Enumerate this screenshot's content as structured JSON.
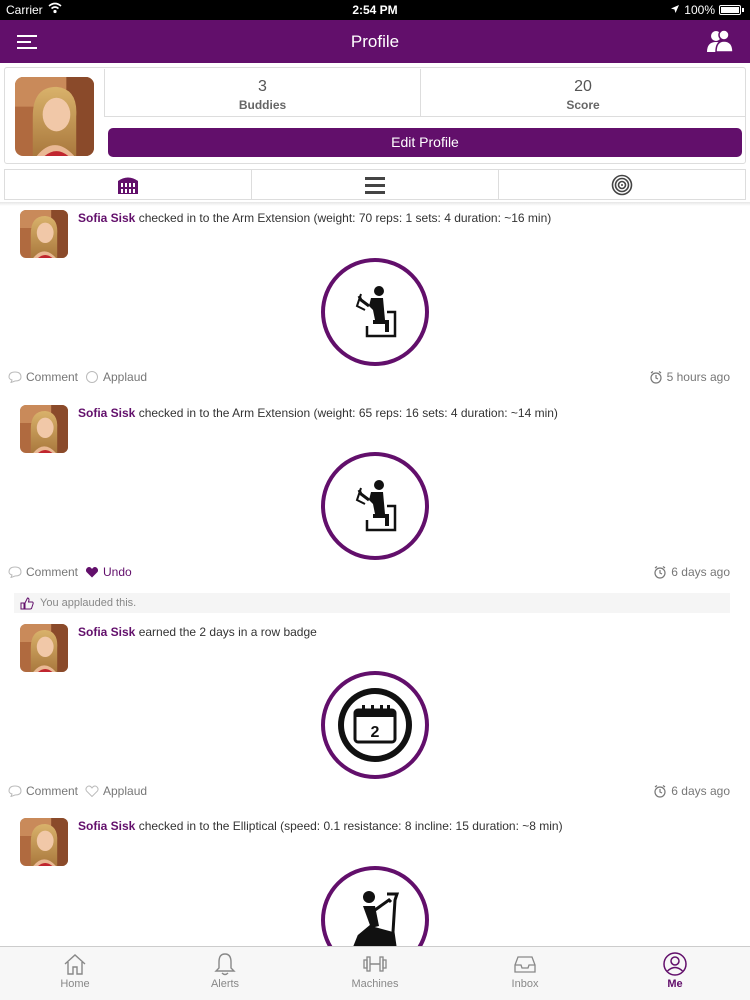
{
  "status_bar": {
    "carrier": "Carrier",
    "time": "2:54 PM",
    "battery": "100%"
  },
  "nav": {
    "title": "Profile"
  },
  "profile": {
    "buddies_count": "3",
    "buddies_label": "Buddies",
    "score_count": "20",
    "score_label": "Score",
    "edit_label": "Edit Profile"
  },
  "tabs": [
    {
      "icon": "building-icon"
    },
    {
      "icon": "list-icon"
    },
    {
      "icon": "target-icon"
    }
  ],
  "feed": [
    {
      "user": "Sofia Sisk",
      "text": "checked in to the Arm Extension (weight: 70 reps: 1 sets: 4 duration: ~16 min)",
      "icon": "arm-extension-machine-icon",
      "comment_label": "Comment",
      "applaud_label": "Applaud",
      "time": "5 hours ago"
    },
    {
      "user": "Sofia Sisk",
      "text": "checked in to the Arm Extension (weight: 65 reps: 16 sets: 4 duration: ~14 min)",
      "icon": "arm-extension-machine-icon",
      "comment_label": "Comment",
      "applaud_label": "Undo",
      "time": "6 days ago",
      "applauded_text": "You applauded this."
    },
    {
      "user": "Sofia Sisk",
      "text": "earned the 2 days in a row badge",
      "icon": "calendar-badge-icon",
      "badge_number": "2",
      "comment_label": "Comment",
      "applaud_label": "Applaud",
      "time": "6 days ago"
    },
    {
      "user": "Sofia Sisk",
      "text": "checked in to the Elliptical (speed: 0.1 resistance: 8 incline: 15 duration: ~8 min)",
      "icon": "elliptical-machine-icon"
    }
  ],
  "tab_bar": [
    {
      "label": "Home",
      "icon": "home-icon"
    },
    {
      "label": "Alerts",
      "icon": "bell-icon"
    },
    {
      "label": "Machines",
      "icon": "dumbbell-icon"
    },
    {
      "label": "Inbox",
      "icon": "inbox-icon"
    },
    {
      "label": "Me",
      "icon": "user-circle-icon",
      "active": true
    }
  ],
  "colors": {
    "brand": "#620f6b"
  }
}
